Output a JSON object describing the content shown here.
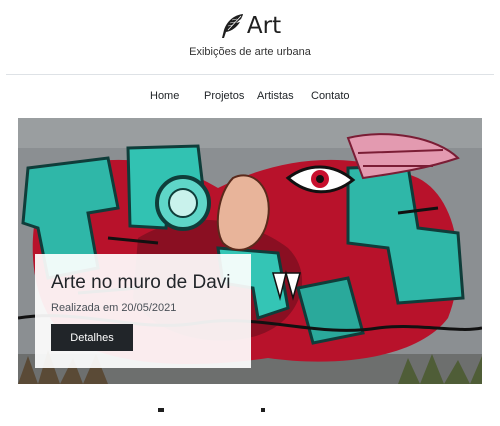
{
  "header": {
    "brand_name": "Art",
    "subtitle": "Exibições de arte urbana",
    "logo_icon": "feather-icon"
  },
  "nav": {
    "items": [
      {
        "label": "Home"
      },
      {
        "label": "Projetos"
      },
      {
        "label": "Artistas"
      },
      {
        "label": "Contato"
      }
    ]
  },
  "hero": {
    "image": "graffiti-mural-image",
    "card": {
      "title": "Arte no muro de Davi",
      "date": "Realizada em 20/05/2021",
      "button_label": "Detalhes"
    }
  },
  "colors": {
    "dark": "#212529",
    "divider": "#dee2e6",
    "teal": "#2fb7a8",
    "red": "#c8102e",
    "pink": "#e39ab0"
  }
}
